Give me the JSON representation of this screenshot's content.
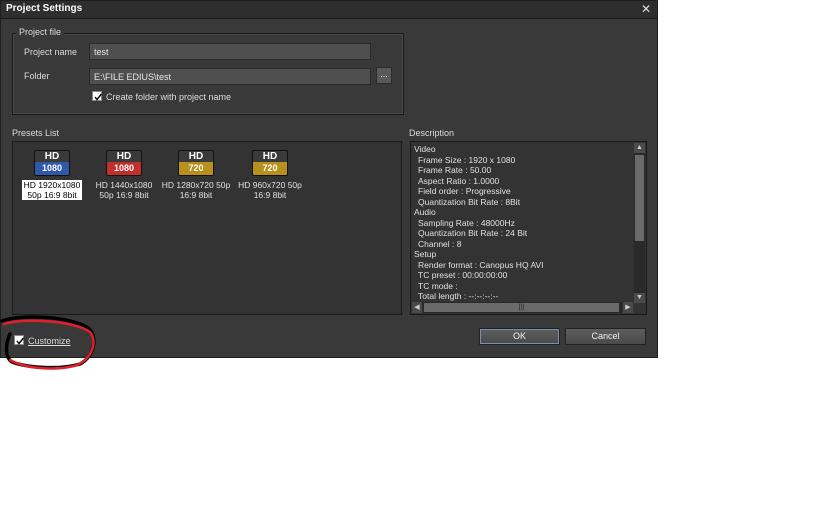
{
  "window": {
    "title": "Project Settings",
    "close_glyph": "✕"
  },
  "project_file": {
    "group_label": "Project file",
    "name_label": "Project name",
    "name_value": "test",
    "folder_label": "Folder",
    "folder_value": "E:\\FILE EDIUS\\test",
    "browse_label": "...",
    "create_folder_label": "Create folder with project name",
    "create_folder_checked": true
  },
  "presets": {
    "label": "Presets List",
    "items": [
      {
        "icon_top": "HD",
        "icon_bottom": "1080",
        "color": "#2f58a8",
        "line1": "HD 1920x1080",
        "line2": "50p 16:9 8bit",
        "selected": true
      },
      {
        "icon_top": "HD",
        "icon_bottom": "1080",
        "color": "#c0302a",
        "line1": "HD 1440x1080",
        "line2": "50p 16:9 8bit",
        "selected": false
      },
      {
        "icon_top": "HD",
        "icon_bottom": "720",
        "color": "#b8901e",
        "line1": "HD 1280x720 50p",
        "line2": "16:9 8bit",
        "selected": false
      },
      {
        "icon_top": "HD",
        "icon_bottom": "720",
        "color": "#b8901e",
        "line1": "HD 960x720 50p",
        "line2": "16:9 8bit",
        "selected": false
      }
    ]
  },
  "description": {
    "label": "Description",
    "lines": [
      {
        "text": "Video",
        "indent": false
      },
      {
        "text": "Frame Size : 1920 x 1080",
        "indent": true
      },
      {
        "text": "Frame Rate : 50.00",
        "indent": true
      },
      {
        "text": "Aspect Ratio : 1.0000",
        "indent": true
      },
      {
        "text": "Field order : Progressive",
        "indent": true
      },
      {
        "text": "Quantization Bit Rate : 8Bit",
        "indent": true
      },
      {
        "text": "Audio",
        "indent": false
      },
      {
        "text": "Sampling Rate : 48000Hz",
        "indent": true
      },
      {
        "text": "Quantization Bit Rate : 24 Bit",
        "indent": true
      },
      {
        "text": "Channel : 8",
        "indent": true
      },
      {
        "text": "Setup",
        "indent": false
      },
      {
        "text": "Render format : Canopus HQ AVI",
        "indent": true
      },
      {
        "text": "TC preset : 00:00:00:00",
        "indent": true
      },
      {
        "text": "TC mode :",
        "indent": true
      },
      {
        "text": "Total length : --:--:--:--",
        "indent": true
      }
    ]
  },
  "customize": {
    "label": "Customize",
    "checked": true
  },
  "buttons": {
    "ok": "OK",
    "cancel": "Cancel"
  },
  "annotation_color": "#e0202a"
}
